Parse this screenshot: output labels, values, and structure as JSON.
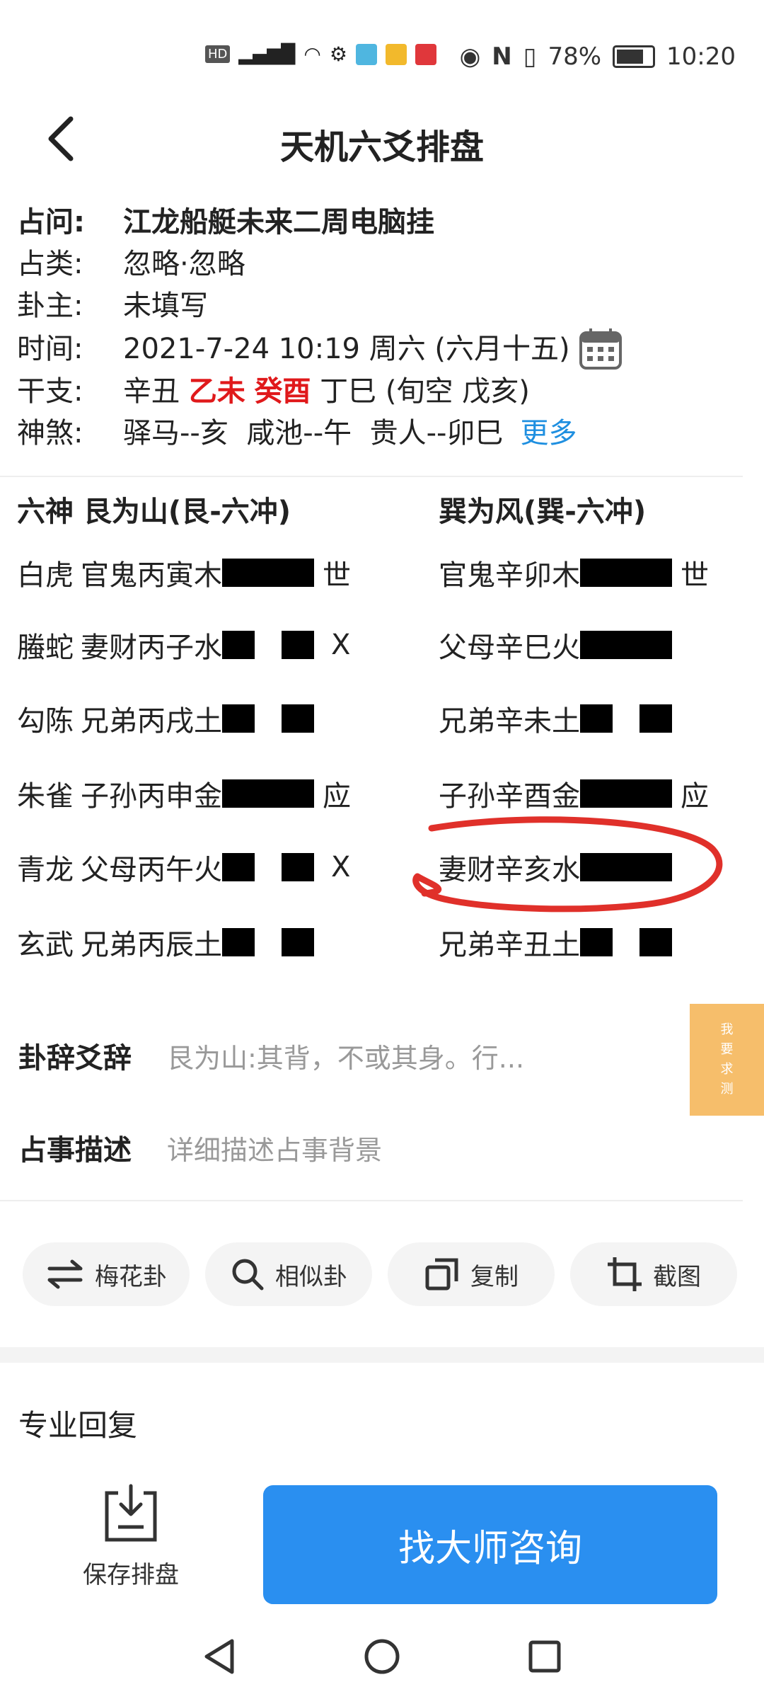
{
  "status_bar": {
    "battery": "78%",
    "time": "10:20",
    "battery_level": 0.78
  },
  "header": {
    "title": "天机六爻排盘"
  },
  "info": {
    "question_label": "占问:",
    "question": "江龙船艇未来二周电脑挂",
    "category_label": "占类:",
    "category": "忽略·忽略",
    "owner_label": "卦主:",
    "owner": "未填写",
    "time_label": "时间:",
    "time": "2021-7-24 10:19 周六 (六月十五)",
    "ganzhi_label": "干支:",
    "ganzhi_year": "辛丑",
    "ganzhi_month": "乙未",
    "ganzhi_day": "癸酉",
    "ganzhi_hour": "丁巳",
    "ganzhi_xunkong": "(旬空 戊亥)",
    "shensha_label": "神煞:",
    "shensha_1": "驿马--亥",
    "shensha_2": "咸池--午",
    "shensha_3": "贵人--卯巳",
    "more": "更多"
  },
  "hexagram": {
    "left_header": "六神  艮为山(艮-六冲)",
    "right_header": "巽为风(巽-六冲)",
    "lines": [
      {
        "spirit": "白虎",
        "left": "官鬼丙寅木",
        "left_type": "yang",
        "left_mark": "世",
        "right": "官鬼辛卯木",
        "right_type": "yang",
        "right_mark": "世"
      },
      {
        "spirit": "螣蛇",
        "left": "妻财丙子水",
        "left_type": "yin",
        "left_mark": "X",
        "right": "父母辛巳火",
        "right_type": "yang",
        "right_mark": ""
      },
      {
        "spirit": "勾陈",
        "left": "兄弟丙戌土",
        "left_type": "yin",
        "left_mark": "",
        "right": "兄弟辛未土",
        "right_type": "yin",
        "right_mark": ""
      },
      {
        "spirit": "朱雀",
        "left": "子孙丙申金",
        "left_type": "yang",
        "left_mark": "应",
        "right": "子孙辛酉金",
        "right_type": "yang",
        "right_mark": "应"
      },
      {
        "spirit": "青龙",
        "left": "父母丙午火",
        "left_type": "yin",
        "left_mark": "X",
        "right": "妻财辛亥水",
        "right_type": "yang",
        "right_mark": ""
      },
      {
        "spirit": "玄武",
        "left": "兄弟丙辰土",
        "left_type": "yin",
        "left_mark": "",
        "right": "兄弟辛丑土",
        "right_type": "yin",
        "right_mark": ""
      }
    ]
  },
  "side_tag": {
    "l1": "我",
    "l2": "要",
    "l3": "求",
    "l4": "测"
  },
  "guaci": {
    "label": "卦辞爻辞",
    "value": "艮为山:其背，不或其身。行..."
  },
  "describe": {
    "label": "占事描述",
    "placeholder": "详细描述占事背景"
  },
  "actions": {
    "meihua": "梅花卦",
    "similar": "相似卦",
    "copy": "复制",
    "screenshot": "截图"
  },
  "reply": {
    "title": "专业回复"
  },
  "footer": {
    "save": "保存排盘",
    "consult": "找大师咨询"
  },
  "colors": {
    "accent_blue": "#2a8ff0",
    "red": "#e0191b",
    "side_tag": "#f6be6b"
  }
}
